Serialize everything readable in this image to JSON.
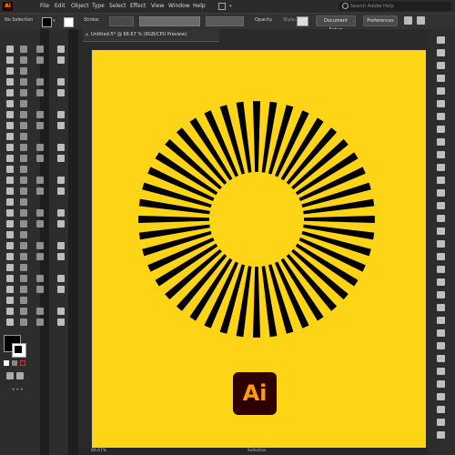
{
  "app": {
    "logo_text": "Ai"
  },
  "menu": {
    "items": [
      "File",
      "Edit",
      "Object",
      "Type",
      "Select",
      "Effect",
      "View",
      "Window",
      "Help"
    ]
  },
  "search": {
    "placeholder": "Search Adobe Help"
  },
  "control_bar": {
    "selection_label": "No Selection",
    "stroke_label": "Stroke:",
    "opacity_label": "Opacity",
    "style_label": "Style:",
    "document_setup": "Document Setup",
    "preferences": "Preferences"
  },
  "document": {
    "tab_title": "Untitled-5* @ 66.67 % (RGB/CPU Preview)",
    "artboard_color": "#fed416"
  },
  "status_bar": {
    "zoom": "66.67%",
    "mode": "Selection"
  },
  "logo": {
    "text": "Ai",
    "bg": "#2e0000",
    "fg": "#ff9a00"
  },
  "icons": [
    "search-icon",
    "close-icon",
    "selection-tool-icon",
    "direct-selection-tool-icon",
    "pen-tool-icon",
    "type-tool-icon",
    "fill-swatch-icon",
    "stroke-swatch-icon"
  ]
}
